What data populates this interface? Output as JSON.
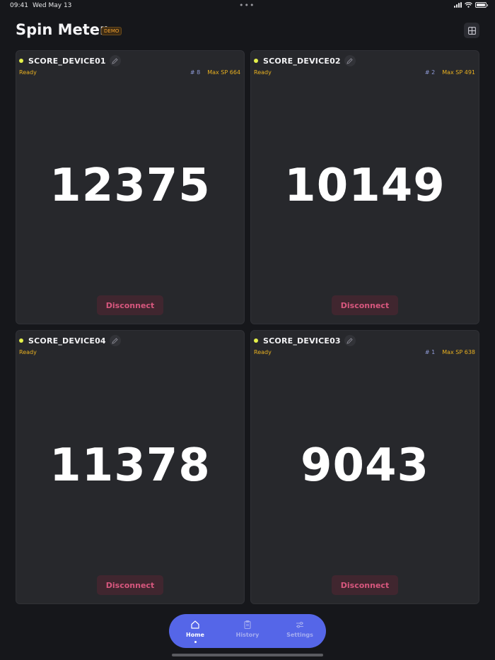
{
  "status_bar": {
    "time": "09:41",
    "date": "Wed May 13",
    "dots": "•••",
    "battery_level": 1.0
  },
  "header": {
    "title": "Spin Meter",
    "badge": "DEMO",
    "layout_icon": "grid-icon"
  },
  "devices": [
    {
      "name": "SCORE_DEVICE01",
      "status": "Ready",
      "rank": "# 8",
      "max_sp": "Max SP 664",
      "score": "12375",
      "button": "Disconnect"
    },
    {
      "name": "SCORE_DEVICE02",
      "status": "Ready",
      "rank": "# 2",
      "max_sp": "Max SP 491",
      "score": "10149",
      "button": "Disconnect"
    },
    {
      "name": "SCORE_DEVICE04",
      "status": "Ready",
      "rank": "",
      "max_sp": "",
      "score": "11378",
      "button": "Disconnect"
    },
    {
      "name": "SCORE_DEVICE03",
      "status": "Ready",
      "rank": "# 1",
      "max_sp": "Max SP 638",
      "score": "9043",
      "button": "Disconnect"
    }
  ],
  "tabs": [
    {
      "label": "Home",
      "icon": "home-icon",
      "active": true
    },
    {
      "label": "History",
      "icon": "clipboard-icon",
      "active": false
    },
    {
      "label": "Settings",
      "icon": "sliders-icon",
      "active": false
    }
  ],
  "colors": {
    "background": "#16171b",
    "card": "#27282c",
    "accent": "#5566e8",
    "ready": "#e8b020",
    "status_dot": "#e4f04a",
    "disconnect_text": "#d8577e"
  }
}
